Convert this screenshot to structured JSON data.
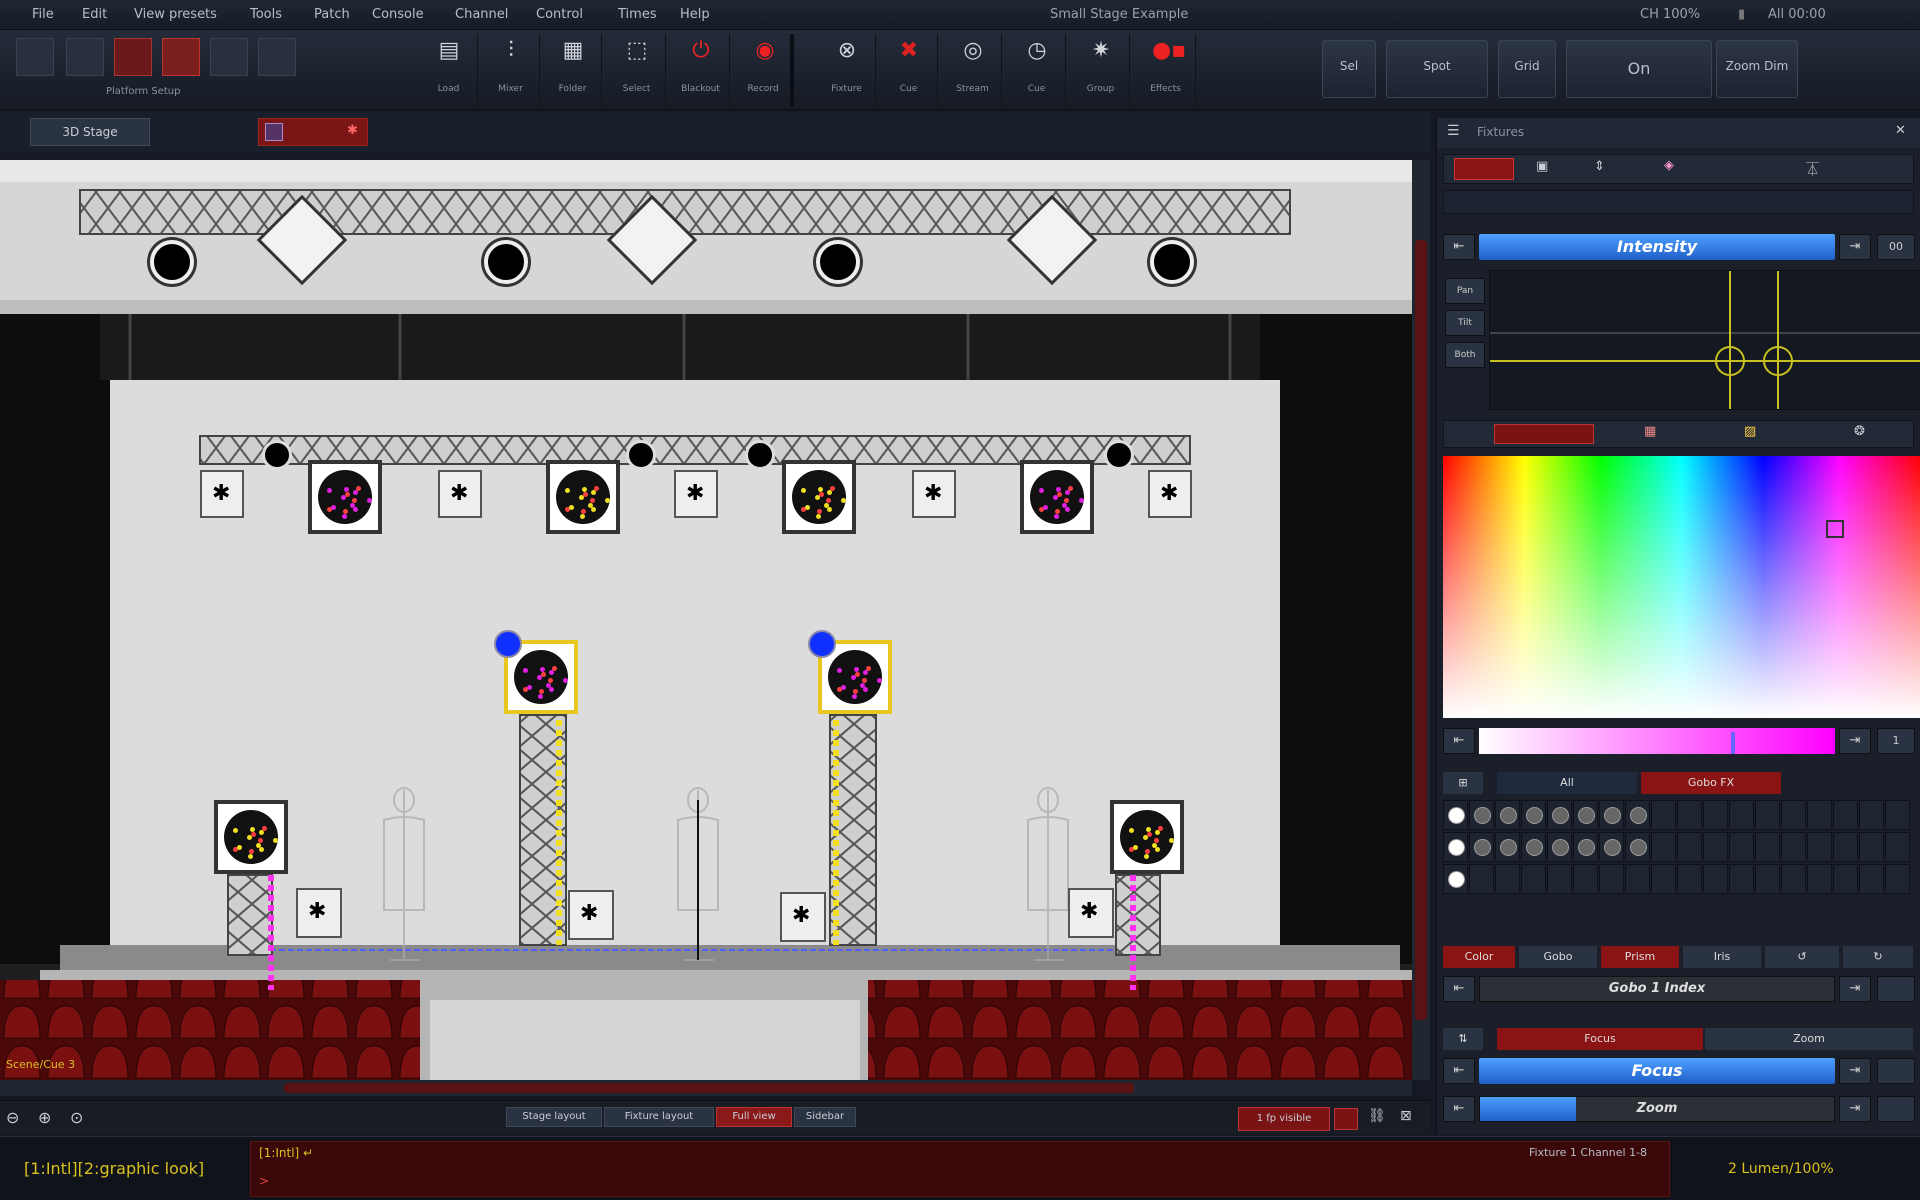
{
  "menu": {
    "items": [
      "File",
      "Edit",
      "View presets",
      "Tools",
      "Patch",
      "Console",
      "Channel",
      "Control",
      "Times",
      "Help"
    ],
    "window_title": "Small Stage Example",
    "right_status": "CH 100%",
    "right_time": "All 00:00"
  },
  "toolbar": {
    "caption": "Platform Setup",
    "buttons": [
      {
        "label": "Load",
        "icon": "save-icon"
      },
      {
        "label": "Mixer",
        "icon": "sliders-icon"
      },
      {
        "label": "Folder",
        "icon": "folder-icon"
      },
      {
        "label": "Select",
        "icon": "select-icon"
      },
      {
        "label": "Blackout",
        "icon": "power-icon"
      },
      {
        "label": "Record",
        "icon": "record-icon"
      },
      {
        "label": "Fixture",
        "icon": "fixture-icon"
      },
      {
        "label": "Cue",
        "icon": "cue-icon"
      },
      {
        "label": "Stream",
        "icon": "eye-icon"
      },
      {
        "label": "Cue",
        "icon": "clock-icon"
      },
      {
        "label": "Group",
        "icon": "gear-icon"
      },
      {
        "label": "Effects",
        "icon": "effects-icon"
      }
    ],
    "right_buttons": [
      "Sel",
      "Spot",
      "Grid",
      "On",
      "Zoom Dim"
    ]
  },
  "view": {
    "tab_label": "3D Stage",
    "status_overlay": "Scene/Cue 3"
  },
  "zoom_buttons": [
    "Stage layout",
    "Fixture layout",
    "Full view",
    "Sidebar"
  ],
  "zoom_badge": "1 fp visible",
  "panel": {
    "title": "Fixtures",
    "intensity_label": "Intensity",
    "pan_tilt_buttons": [
      "Pan",
      "Tilt",
      "Both"
    ],
    "color_tabs": [
      "Color",
      "Gobo",
      "Prism",
      "Iris"
    ],
    "gobo_label": "Gobo 1 Index",
    "gobo_row_tabs": [
      "All",
      "Gobo FX"
    ],
    "focus_label": "Focus",
    "zoom_label": "Zoom",
    "focus_row_tabs": [
      "Focus",
      "Zoom"
    ],
    "num_small": "1",
    "selected_color": "#ff00ff"
  },
  "command": {
    "history": "[1:Intl][2:graphic look]",
    "prompt_line": "[1:Intl] ↵",
    "prompt_char": ">",
    "right_info": "Fixture 1 Channel 1-8",
    "right_counter": "2 Lumen/100%"
  }
}
